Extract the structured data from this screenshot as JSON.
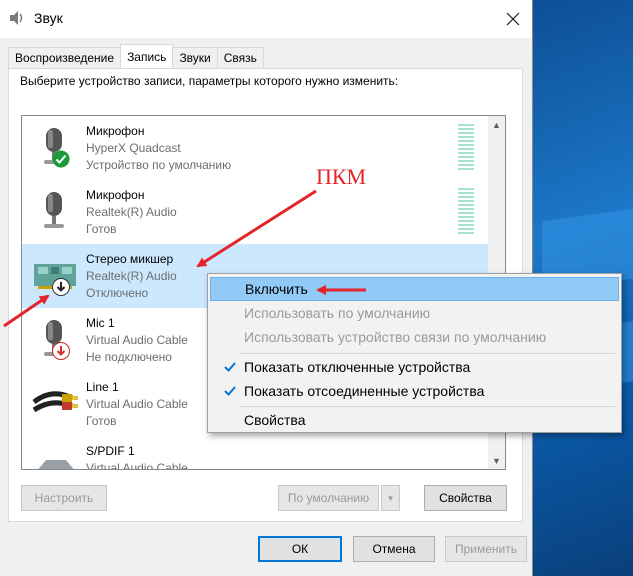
{
  "window": {
    "title": "Звук"
  },
  "tabs": [
    {
      "label": "Воспроизведение"
    },
    {
      "label": "Запись"
    },
    {
      "label": "Звуки"
    },
    {
      "label": "Связь"
    }
  ],
  "active_tab": "Запись",
  "instruction": "Выберите устройство записи, параметры которого нужно изменить:",
  "devices": [
    {
      "name": "Микрофон",
      "driver": "HyperX Quadcast",
      "status": "Устройство по умолчанию",
      "icon": "microphone-icon",
      "badge": "default-check-icon"
    },
    {
      "name": "Микрофон",
      "driver": "Realtek(R) Audio",
      "status": "Готов",
      "icon": "microphone-icon"
    },
    {
      "name": "Стерео микшер",
      "driver": "Realtek(R) Audio",
      "status": "Отключено",
      "icon": "soundcard-icon",
      "badge": "disabled-arrow-icon"
    },
    {
      "name": "Mic 1",
      "driver": "Virtual Audio Cable",
      "status": "Не подключено",
      "icon": "microphone-icon",
      "badge": "unplugged-arrow-icon"
    },
    {
      "name": "Line 1",
      "driver": "Virtual Audio Cable",
      "status": "Готов",
      "icon": "rca-cable-icon"
    },
    {
      "name": "S/PDIF 1",
      "driver": "Virtual Audio Cable",
      "status": "",
      "icon": "spdif-icon"
    }
  ],
  "context_menu": {
    "items": [
      {
        "label": "Включить"
      },
      {
        "label": "Использовать по умолчанию"
      },
      {
        "label": "Использовать устройство связи по умолчанию"
      },
      {
        "label": "Показать отключенные устройства"
      },
      {
        "label": "Показать отсоединенные устройства"
      },
      {
        "label": "Свойства"
      }
    ]
  },
  "annotation": {
    "label": "ПКМ",
    "color": "#e3242b"
  },
  "buttons": {
    "configure": "Настроить",
    "set_default": "По умолчанию",
    "properties": "Свойства",
    "ok": "ОК",
    "cancel": "Отмена",
    "apply": "Применить"
  },
  "colors": {
    "selection": "#cce8ff",
    "menu_highlight": "#91c9f7",
    "accent": "#0078d7",
    "meter": "#a7e3cf"
  }
}
